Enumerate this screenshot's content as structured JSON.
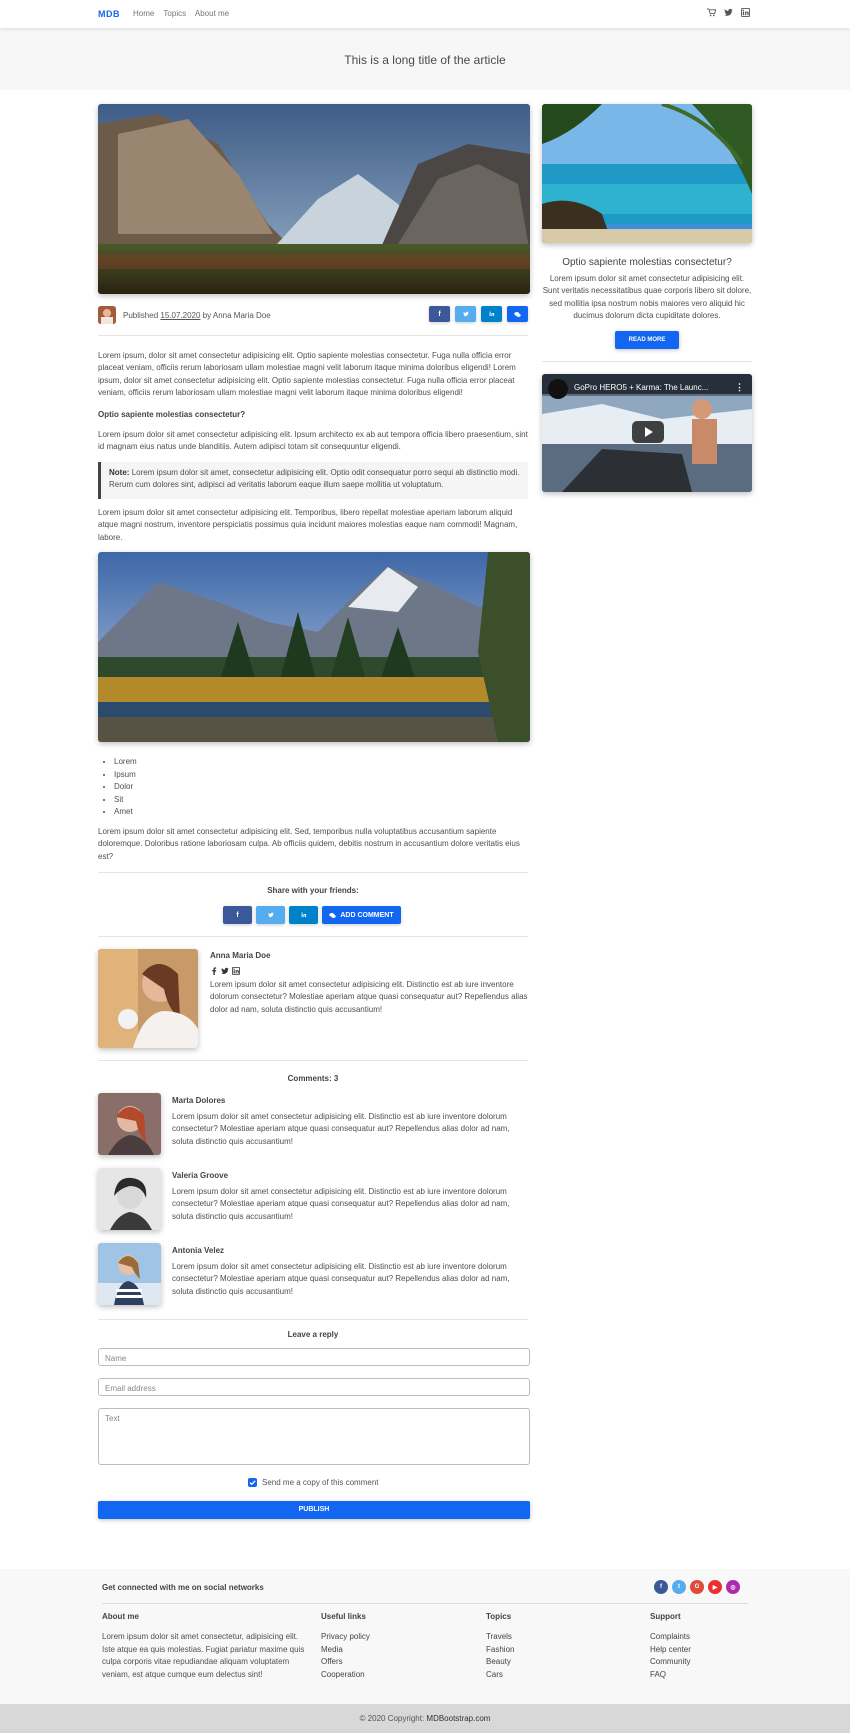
{
  "nav": {
    "brand": "MDB",
    "links": [
      "Home",
      "Topics",
      "About me"
    ],
    "icons": [
      "cart-icon",
      "twitter-icon",
      "linkedin-icon"
    ]
  },
  "hero": {
    "title": "This is a long title of the article"
  },
  "meta": {
    "published_prefix": "Published",
    "date": "15.07.2020",
    "by": "by",
    "author": "Anna Maria Doe"
  },
  "article": {
    "p1": "Lorem ipsum, dolor sit amet consectetur adipisicing elit. Optio sapiente molestias consectetur. Fuga nulla officia error placeat veniam, officiis rerum laboriosam ullam molestiae magni velit laborum itaque minima doloribus eligendi! Lorem ipsum, dolor sit amet consectetur adipisicing elit. Optio sapiente molestias consectetur. Fuga nulla officia error placeat veniam, officiis rerum laboriosam ullam molestiae magni velit laborum itaque minima doloribus eligendi!",
    "subheading": "Optio sapiente molestias consectetur?",
    "p2": "Lorem ipsum dolor sit amet consectetur adipisicing elit. Ipsum architecto ex ab aut tempora officia libero praesentium, sint id magnam eius natus unde blanditiis. Autem adipisci totam sit consequuntur eligendi.",
    "note_label": "Note:",
    "note_text": "Lorem ipsum dolor sit amet, consectetur adipisicing elit. Optio odit consequatur porro sequi ab distinctio modi. Rerum cum dolores sint, adipisci ad veritatis laborum eaque illum saepe mollitia ut voluptatum.",
    "p3": "Lorem ipsum dolor sit amet consectetur adipisicing elit. Temporibus, libero repellat molestiae aperiam laborum aliquid atque magni nostrum, inventore perspiciatis possimus quia incidunt maiores molestias eaque nam commodi! Magnam, labore.",
    "list": [
      "Lorem",
      "Ipsum",
      "Dolor",
      "Sit",
      "Amet"
    ],
    "p4": "Lorem ipsum dolor sit amet consectetur adipisicing elit. Sed, temporibus nulla voluptatibus accusantium sapiente doloremque. Doloribus ratione laboriosam culpa. Ab officiis quidem, debitis nostrum in accusantium dolore veritatis eius est?"
  },
  "share": {
    "title": "Share with your friends:",
    "add_comment": "ADD COMMENT"
  },
  "author_box": {
    "name": "Anna Maria Doe",
    "bio": "Lorem ipsum dolor sit amet consectetur adipisicing elit. Distinctio est ab iure inventore dolorum consectetur? Molestiae aperiam atque quasi consequatur aut? Repellendus alias dolor ad nam, soluta distinctio quis accusantium!"
  },
  "comments": {
    "title": "Comments: 3",
    "items": [
      {
        "name": "Marta Dolores",
        "text": "Lorem ipsum dolor sit amet consectetur adipisicing elit. Distinctio est ab iure inventore dolorum consectetur? Molestiae aperiam atque quasi consequatur aut? Repellendus alias dolor ad nam, soluta distinctio quis accusantium!"
      },
      {
        "name": "Valeria Groove",
        "text": "Lorem ipsum dolor sit amet consectetur adipisicing elit. Distinctio est ab iure inventore dolorum consectetur? Molestiae aperiam atque quasi consequatur aut? Repellendus alias dolor ad nam, soluta distinctio quis accusantium!"
      },
      {
        "name": "Antonia Velez",
        "text": "Lorem ipsum dolor sit amet consectetur adipisicing elit. Distinctio est ab iure inventore dolorum consectetur? Molestiae aperiam atque quasi consequatur aut? Repellendus alias dolor ad nam, soluta distinctio quis accusantium!"
      }
    ]
  },
  "reply": {
    "title": "Leave a reply",
    "name_placeholder": "Name",
    "email_placeholder": "Email address",
    "text_placeholder": "Text",
    "copy_label": "Send me a copy of this comment",
    "copy_checked": true,
    "publish": "PUBLISH"
  },
  "sidebar": {
    "title": "Optio sapiente molestias consectetur?",
    "text": "Lorem ipsum dolor sit amet consectetur adipisicing elit. Sunt veritatis necessitatibus quae corporis libero sit dolore, sed mollitia ipsa nostrum nobis maiores vero aliquid hic ducimus dolorum dicta cupiditate dolores.",
    "read_more": "READ MORE",
    "video_title": "GoPro HERO5 + Karma: The Launc..."
  },
  "footer": {
    "connect": "Get connected with me on social networks",
    "social": [
      "facebook-icon",
      "twitter-icon",
      "google-icon",
      "youtube-icon",
      "instagram-icon"
    ],
    "about_title": "About me",
    "about_text": "Lorem ipsum dolor sit amet consectetur, adipisicing elit. Iste atque ea quis molestias. Fugiat pariatur maxime quis culpa corporis vitae repudiandae aliquam voluptatem veniam, est atque cumque eum delectus sint!",
    "useful_title": "Useful links",
    "useful_links": [
      "Privacy policy",
      "Media",
      "Offers",
      "Cooperation"
    ],
    "topics_title": "Topics",
    "topics_links": [
      "Travels",
      "Fashion",
      "Beauty",
      "Cars"
    ],
    "support_title": "Support",
    "support_links": [
      "Complaints",
      "Help center",
      "Community",
      "FAQ"
    ],
    "copyright_prefix": "© 2020 Copyright:",
    "copyright_site": "MDBootstrap.com"
  },
  "colors": {
    "primary": "#1266f1",
    "facebook": "#3b5998",
    "twitter": "#55acee",
    "linkedin": "#0082ca"
  }
}
